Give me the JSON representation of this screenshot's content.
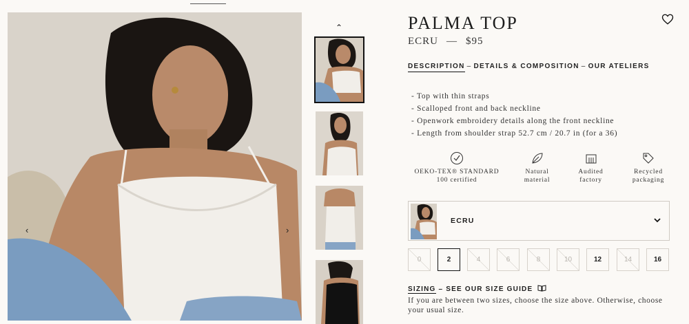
{
  "product": {
    "title": "PALMA TOP",
    "color": "ECRU",
    "separator": "—",
    "price": "$95"
  },
  "tabs": [
    {
      "label": "DESCRIPTION",
      "active": true
    },
    {
      "label": "DETAILS & COMPOSITION",
      "active": false
    },
    {
      "label": "OUR ATELIERS",
      "active": false
    }
  ],
  "tab_separator": "–",
  "features": [
    "- Top with thin straps",
    "- Scalloped front and back neckline",
    "- Openwork embroidery details along the front neckline",
    "- Length from shoulder strap 52.7 cm / 20.7 in (for a 36)"
  ],
  "badges": [
    {
      "line1": "OEKO-TEX® STANDARD",
      "line2": "100 certified",
      "icon": "check-circle-icon"
    },
    {
      "line1": "Natural",
      "line2": "material",
      "icon": "leaf-icon"
    },
    {
      "line1": "Audited",
      "line2": "factory",
      "icon": "factory-icon"
    },
    {
      "line1": "Recycled",
      "line2": "packaging",
      "icon": "tag-icon"
    }
  ],
  "color_selector": {
    "label": "ECRU"
  },
  "sizes": [
    {
      "label": "0",
      "available": false,
      "selected": false
    },
    {
      "label": "2",
      "available": true,
      "selected": true
    },
    {
      "label": "4",
      "available": false,
      "selected": false
    },
    {
      "label": "6",
      "available": false,
      "selected": false
    },
    {
      "label": "8",
      "available": false,
      "selected": false
    },
    {
      "label": "10",
      "available": false,
      "selected": false
    },
    {
      "label": "12",
      "available": true,
      "selected": false
    },
    {
      "label": "14",
      "available": false,
      "selected": false
    },
    {
      "label": "16",
      "available": true,
      "selected": false
    }
  ],
  "sizing": {
    "label": "SIZING",
    "separator": "–",
    "guide_label": "SEE OUR SIZE GUIDE",
    "note": "If you are between two sizes, choose the size above. Otherwise, choose your usual size."
  },
  "gallery": {
    "prev_glyph": "‹",
    "next_glyph": "›",
    "thumbs_up_glyph": "⌃"
  },
  "colors": {
    "background": "#fbf9f6",
    "text": "#1e1e1e",
    "border": "#cfcac3"
  }
}
